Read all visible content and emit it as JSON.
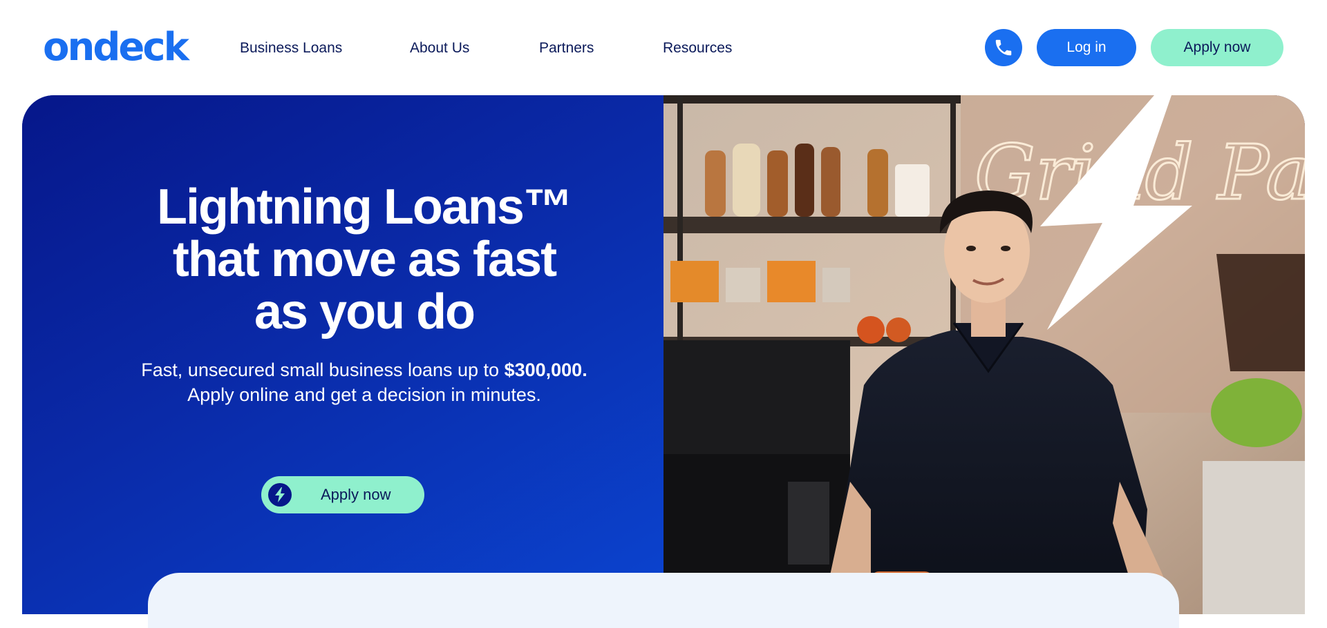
{
  "header": {
    "logo_text": "ondeck",
    "nav": [
      {
        "label": "Business Loans"
      },
      {
        "label": "About Us"
      },
      {
        "label": "Partners"
      },
      {
        "label": "Resources"
      }
    ],
    "phone_icon": "phone-icon",
    "login_label": "Log in",
    "apply_label": "Apply now"
  },
  "hero": {
    "title_lines": [
      "Lightning Loans™",
      "that move as fast",
      "as you do"
    ],
    "subtitle_part1": "Fast, unsecured small business loans up to ",
    "subtitle_amount": "$300,000.",
    "subtitle_part2": " Apply online and get a decision in minutes.",
    "cta_label": "Apply now",
    "cta_icon": "lightning-bolt-icon",
    "photo_neon_text": "Grind Pantry"
  },
  "colors": {
    "brand_blue": "#1a6ff0",
    "navy": "#0b1a5a",
    "mint": "#8ff0cd",
    "hero_blue": "#0a2aa8"
  }
}
